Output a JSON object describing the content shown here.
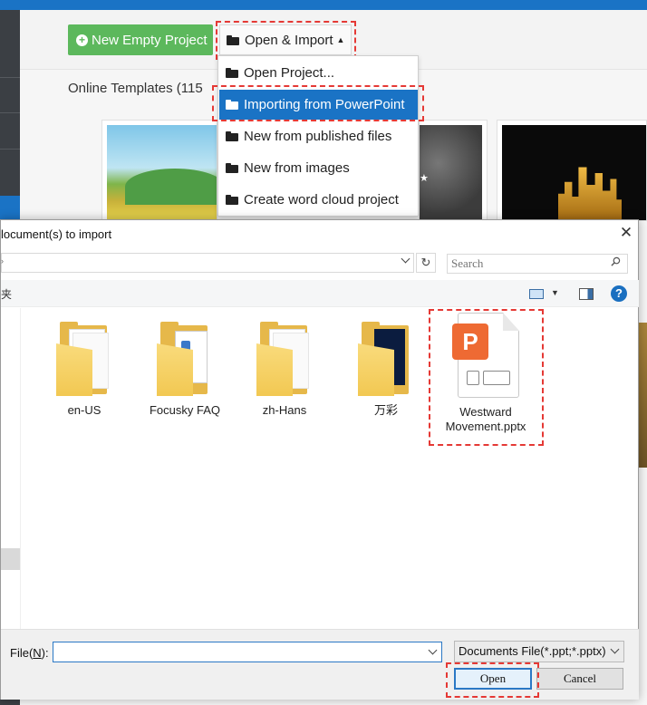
{
  "app": {
    "new_project_label": "New Empty Project",
    "open_import_label": "Open & Import",
    "templates_title": "Online Templates (115"
  },
  "menu": {
    "items": [
      {
        "label": "Open Project..."
      },
      {
        "label": "Importing from PowerPoint"
      },
      {
        "label": "New from published files"
      },
      {
        "label": "New from images"
      },
      {
        "label": "Create word cloud project"
      }
    ]
  },
  "dialog": {
    "title": "locument(s) to import",
    "search_placeholder": "Search",
    "toolbar_left_text": "夹",
    "files": [
      {
        "name": "en-US",
        "icon": "folder-icon"
      },
      {
        "name": "Focusky FAQ",
        "icon": "folder-icon"
      },
      {
        "name": "zh-Hans",
        "icon": "folder-icon"
      },
      {
        "name": "万彩",
        "icon": "folder-icon"
      },
      {
        "name": "Westward Movement.pptx",
        "icon": "pptx-file-icon"
      }
    ],
    "file_label": "File(",
    "file_label_key": "N",
    "file_label_end": "):",
    "file_value": "",
    "filter_value": "Documents File(*.ppt;*.pptx)",
    "open_button": "Open",
    "cancel_button": "Cancel"
  },
  "colors": {
    "accent_blue": "#1a73c5",
    "green_button": "#5cb85c",
    "highlight_red": "#e53935"
  }
}
